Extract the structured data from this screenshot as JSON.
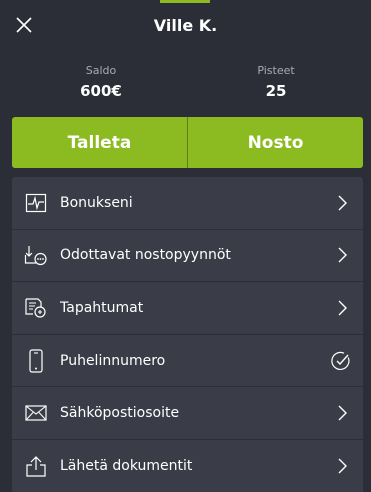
{
  "header": {
    "title": "Ville K."
  },
  "stats": {
    "balance": {
      "label": "Saldo",
      "value": "600€"
    },
    "points": {
      "label": "Pisteet",
      "value": "25"
    }
  },
  "actions": {
    "deposit": "Talleta",
    "withdraw": "Nosto"
  },
  "menu": {
    "items": [
      {
        "label": "Bonukseni",
        "icon": "chart-icon",
        "trailing": "chevron"
      },
      {
        "label": "Odottavat nostopyynnöt",
        "icon": "pending-withdraw-icon",
        "trailing": "chevron"
      },
      {
        "label": "Tapahtumat",
        "icon": "transactions-icon",
        "trailing": "chevron"
      },
      {
        "label": "Puhelinnumero",
        "icon": "phone-icon",
        "trailing": "verified-check"
      },
      {
        "label": "Sähköpostiosoite",
        "icon": "envelope-icon",
        "trailing": "chevron"
      },
      {
        "label": "Lähetä dokumentit",
        "icon": "upload-icon",
        "trailing": "chevron"
      }
    ]
  },
  "colors": {
    "accent": "#8cbb21",
    "background": "#2b2e37",
    "panel": "#3a3d47"
  }
}
